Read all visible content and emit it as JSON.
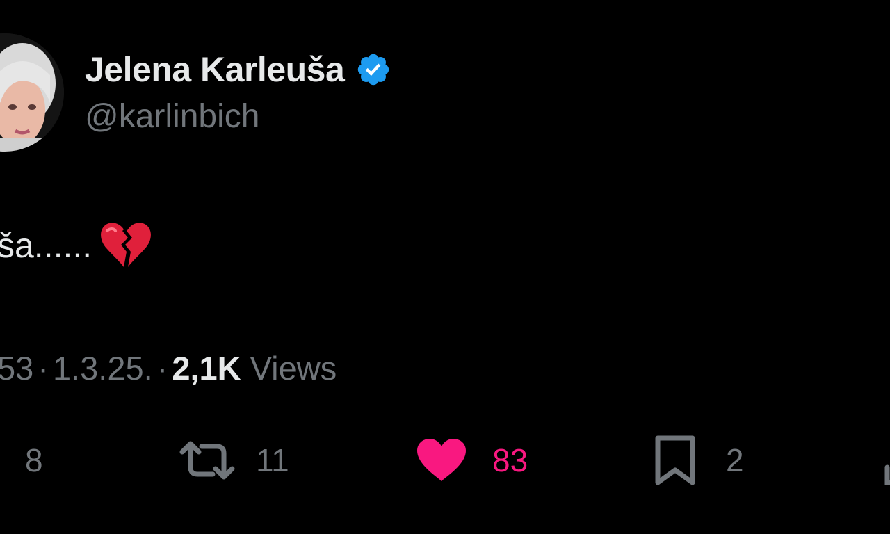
{
  "author": {
    "display_name": "Jelena Karleuša",
    "handle": "@karlinbich",
    "verified_icon": "verified-badge-icon",
    "verified_color": "#1d9bf0"
  },
  "tweet": {
    "text": "ša......",
    "emoji": "broken-heart-icon"
  },
  "meta": {
    "time_fragment": "53",
    "separator": "·",
    "date": "1.3.25.",
    "views_count": "2,1K",
    "views_label": "Views"
  },
  "actions": {
    "replies": {
      "icon": "reply-icon",
      "count": "8"
    },
    "reposts": {
      "icon": "repost-icon",
      "count": "11"
    },
    "likes": {
      "icon": "heart-icon",
      "count": "83",
      "color": "#f91880"
    },
    "bookmarks": {
      "icon": "bookmark-icon",
      "count": "2"
    }
  },
  "colors": {
    "background": "#000000",
    "primary_text": "#e7e9ea",
    "secondary_text": "#71767b"
  }
}
